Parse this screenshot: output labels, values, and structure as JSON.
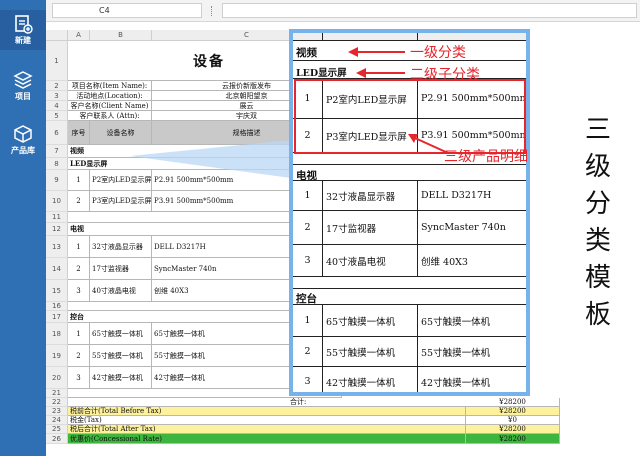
{
  "sidebar": {
    "items": [
      {
        "label": "新建",
        "icon": "new-document-icon"
      },
      {
        "label": "项目",
        "icon": "layers-icon"
      },
      {
        "label": "产品库",
        "icon": "cube-icon"
      }
    ]
  },
  "formula_bar": {
    "cell_ref": "C4",
    "fx_separator": "⋮",
    "value": ""
  },
  "sheet": {
    "columns": [
      "A",
      "B",
      "C"
    ],
    "rows": [
      "1",
      "2",
      "3",
      "4",
      "5",
      "6",
      "7",
      "8",
      "9",
      "10",
      "11",
      "12",
      "13",
      "14",
      "15",
      "16",
      "17",
      "18",
      "19",
      "20",
      "21",
      "22",
      "23",
      "24",
      "25",
      "26"
    ],
    "title": "设备",
    "info": [
      {
        "label": "项目名称(Item Name):",
        "value": "云报价新版发布"
      },
      {
        "label": "活动地点(Location):",
        "value": "北京朝阳望京"
      },
      {
        "label": "客户名称(Client Name)",
        "value": "展云"
      },
      {
        "label": "客户联系人 (Attn):",
        "value": "宇庆双"
      }
    ],
    "header": {
      "no": "序号",
      "name": "设备名称",
      "desc": "规格描述"
    },
    "sections": [
      {
        "title": "视频"
      },
      {
        "title": "LED显示屏"
      },
      {
        "title": "电视"
      },
      {
        "title": "控台"
      }
    ],
    "items": [
      {
        "no": "1",
        "name": "P2室内LED显示屏",
        "spec": "P2.91 500mm*500mm"
      },
      {
        "no": "2",
        "name": "P3室内LED显示屏",
        "spec": "P3.91 500mm*500mm"
      },
      {
        "no": "1",
        "name": "32寸液晶显示器",
        "spec": "DELL  D3217H"
      },
      {
        "no": "2",
        "name": "17寸监视器",
        "spec": "SyncMaster 740n"
      },
      {
        "no": "3",
        "name": "40寸液晶电视",
        "spec": "创维  40X3"
      },
      {
        "no": "1",
        "name": "65寸触摸一体机",
        "spec": "65寸触摸一体机"
      },
      {
        "no": "2",
        "name": "55寸触摸一体机",
        "spec": "55寸触摸一体机"
      },
      {
        "no": "3",
        "name": "42寸触摸一体机",
        "spec": "42寸触摸一体机"
      }
    ],
    "totals": {
      "subtotal_label": "合计:",
      "subtotal_value": "¥28200",
      "before_tax_label": "税前合计(Total Before Tax)",
      "before_tax_value": "¥28200",
      "tax_label": "税金(Tax)",
      "tax_value": "¥0",
      "after_tax_label": "税后合计(Total After Tax)",
      "after_tax_value": "¥28200",
      "concession_label": "优惠价(Concessional Rate)",
      "concession_value": "¥28200"
    }
  },
  "annotations": {
    "level1": "一级分类",
    "level2": "二级子分类",
    "level3": "三级产品明细",
    "vertical_title": "三级分类模板",
    "vertical_chars": [
      "三",
      "级",
      "分",
      "类",
      "模",
      "板"
    ],
    "color": "#e5262d",
    "callout_border": "#77b2ea"
  }
}
